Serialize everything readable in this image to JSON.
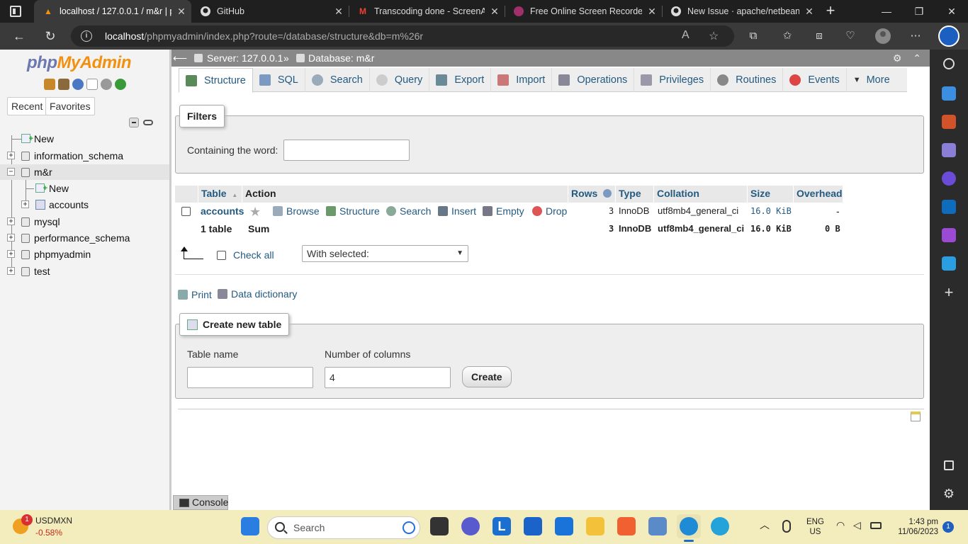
{
  "browser": {
    "tabs": [
      {
        "title": "localhost / 127.0.0.1 / m&r | p",
        "active": true,
        "favicon": "phpmyadmin-icon"
      },
      {
        "title": "GitHub",
        "active": false,
        "favicon": "github-icon"
      },
      {
        "title": "Transcoding done - ScreenAp",
        "active": false,
        "favicon": "gmail-icon"
      },
      {
        "title": "Free Online Screen Recorder |",
        "active": false,
        "favicon": "screenapp-icon"
      },
      {
        "title": "New Issue · apache/netbeans",
        "active": false,
        "favicon": "github-icon"
      }
    ],
    "url_host": "localhost",
    "url_path": "/phpmyadmin/index.php?route=/database/structure&db=m%26r"
  },
  "nav": {
    "logo_php": "php",
    "logo_my": "MyAdmin",
    "tab_recent": "Recent",
    "tab_favorites": "Favorites",
    "tree": {
      "new": "New",
      "databases": [
        "information_schema",
        "m&r",
        "mysql",
        "performance_schema",
        "phpmyadmin",
        "test"
      ],
      "sub_new": "New",
      "sub_table": "accounts"
    }
  },
  "breadcrumb": {
    "server": "Server: 127.0.0.1",
    "separator": "»",
    "database": "Database: m&r"
  },
  "menu": [
    "Structure",
    "SQL",
    "Search",
    "Query",
    "Export",
    "Import",
    "Operations",
    "Privileges",
    "Routines",
    "Events",
    "More"
  ],
  "filters": {
    "legend": "Filters",
    "label": "Containing the word:",
    "value": ""
  },
  "table": {
    "headers": {
      "table": "Table",
      "sort": "▲",
      "action": "Action",
      "rows": "Rows",
      "type": "Type",
      "collation": "Collation",
      "size": "Size",
      "overhead": "Overhead"
    },
    "row": {
      "name": "accounts",
      "actions": [
        "Browse",
        "Structure",
        "Search",
        "Insert",
        "Empty",
        "Drop"
      ],
      "rows": "3",
      "type": "InnoDB",
      "collation": "utf8mb4_general_ci",
      "size": "16.0 KiB",
      "overhead": "-"
    },
    "summary": {
      "count": "1 table",
      "sum": "Sum",
      "rows": "3",
      "type": "InnoDB",
      "collation": "utf8mb4_general_ci",
      "size": "16.0 KiB",
      "overhead": "0 B"
    },
    "check_all": "Check all",
    "with_selected": "With selected:"
  },
  "links": {
    "print": "Print",
    "data_dictionary": "Data dictionary"
  },
  "create_table": {
    "legend": "Create new table",
    "table_name_label": "Table name",
    "table_name_value": "",
    "columns_label": "Number of columns",
    "columns_value": "4",
    "create_button": "Create"
  },
  "console": "Console",
  "taskbar": {
    "ticker_name": "USDMXN",
    "ticker_change": "-0.58%",
    "ticker_badge": "1",
    "search_placeholder": "Search",
    "lang_1": "ENG",
    "lang_2": "US",
    "time": "1:43 pm",
    "date": "11/06/2023",
    "notif_count": "1"
  },
  "colors": {
    "link": "#235a81",
    "logo_php": "#6c78af",
    "logo_my": "#f29111",
    "taskbar": "#f3edbd"
  }
}
